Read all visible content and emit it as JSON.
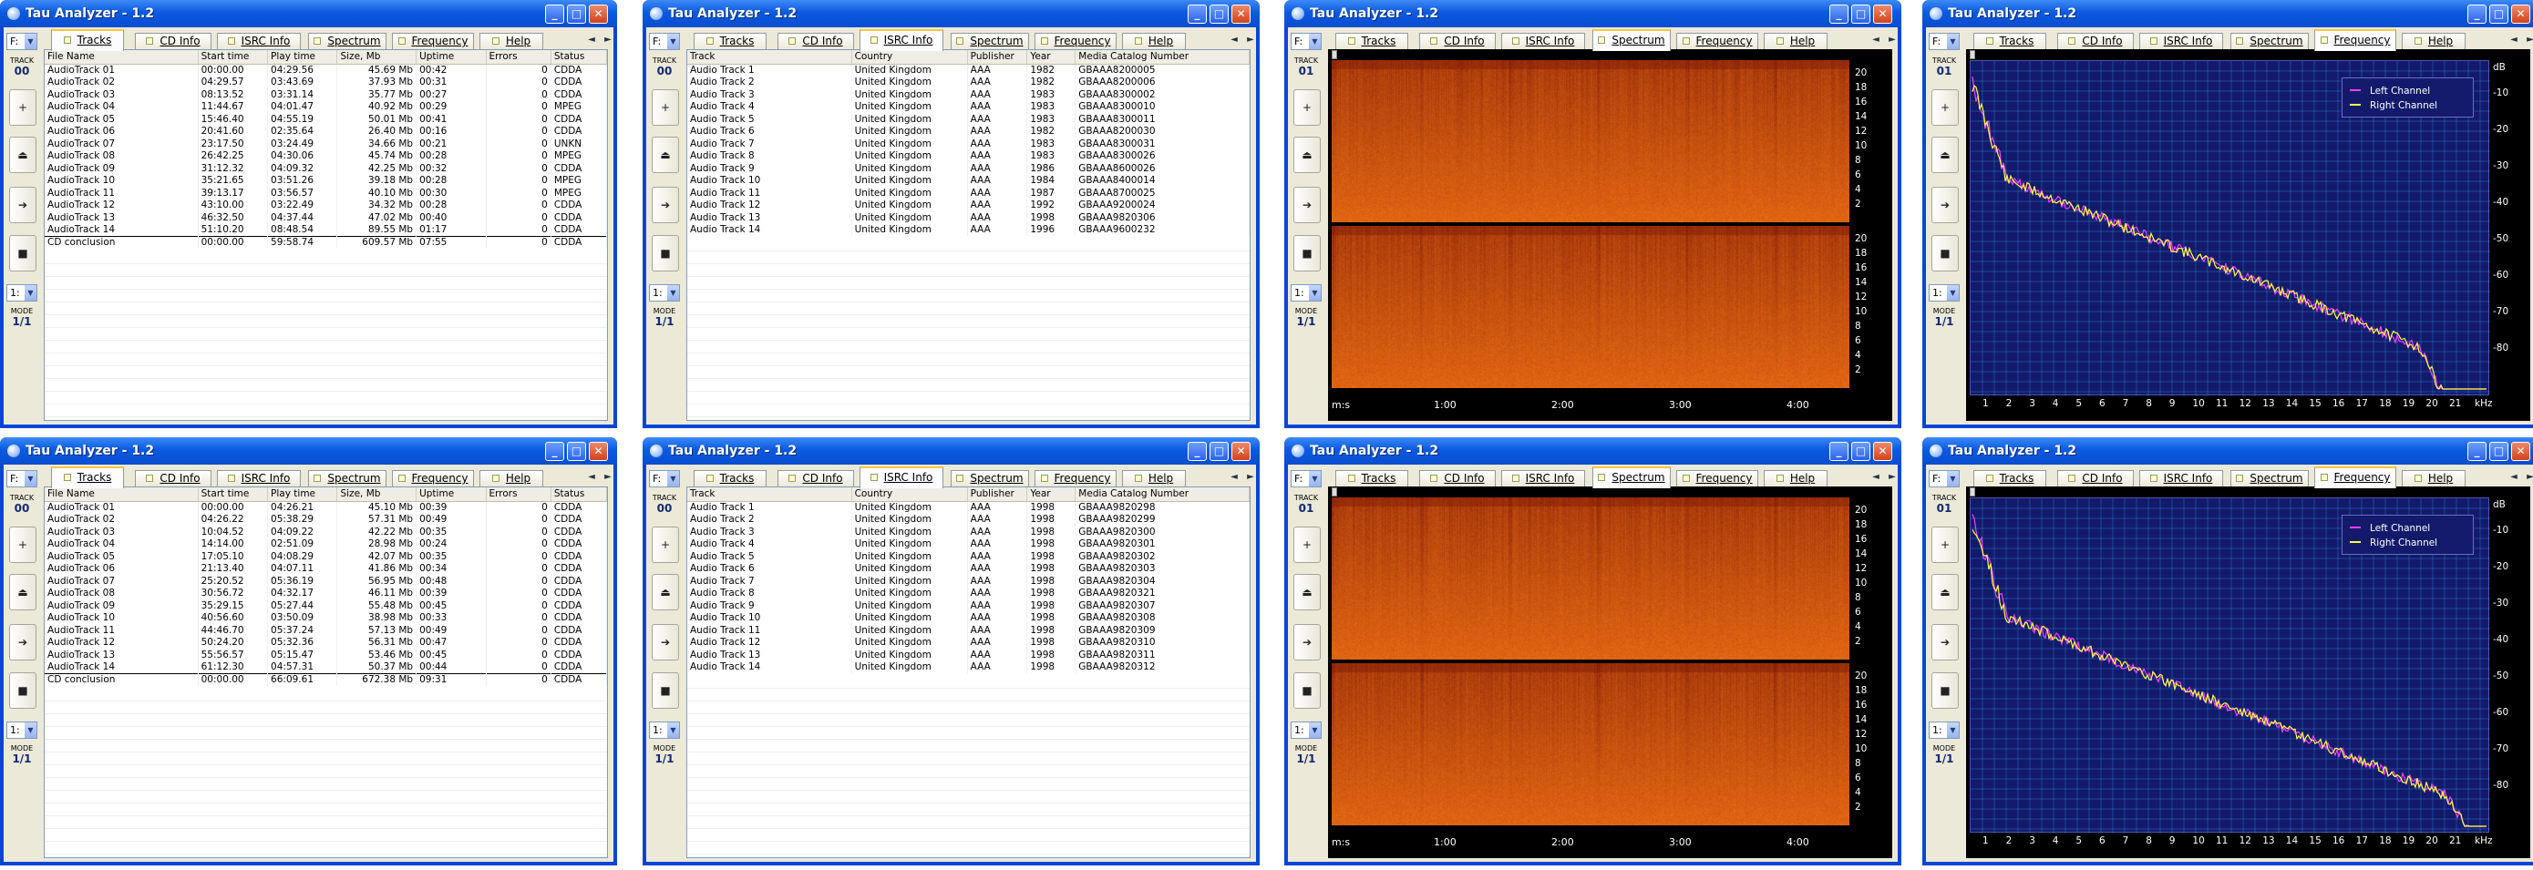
{
  "app_title": "Tau Analyzer - 1.2",
  "tabs": [
    "Tracks",
    "CD Info",
    "ISRC Info",
    "Spectrum",
    "Frequency",
    "Help"
  ],
  "sidebar": {
    "drive": "F:",
    "track_label": "TRACK",
    "mode_label": "MODE",
    "mode_value": "1/1",
    "small_select": "1:"
  },
  "windows": [
    {
      "id": "w1",
      "view": "tracks",
      "track_num": "00",
      "columns": [
        "File Name",
        "Start time",
        "Play time",
        "Size, Mb",
        "Uptime",
        "Errors",
        "Status"
      ],
      "rows": [
        [
          "AudioTrack 01",
          "00:00.00",
          "04:29.56",
          "45.69 Mb",
          "00:42",
          "0",
          "CDDA"
        ],
        [
          "AudioTrack 02",
          "04:29.57",
          "03:43.69",
          "37.93 Mb",
          "00:31",
          "0",
          "CDDA"
        ],
        [
          "AudioTrack 03",
          "08:13.52",
          "03:31.14",
          "35.77 Mb",
          "00:27",
          "0",
          "CDDA"
        ],
        [
          "AudioTrack 04",
          "11:44.67",
          "04:01.47",
          "40.92 Mb",
          "00:29",
          "0",
          "MPEG"
        ],
        [
          "AudioTrack 05",
          "15:46.40",
          "04:55.19",
          "50.01 Mb",
          "00:41",
          "0",
          "CDDA"
        ],
        [
          "AudioTrack 06",
          "20:41.60",
          "02:35.64",
          "26.40 Mb",
          "00:16",
          "0",
          "CDDA"
        ],
        [
          "AudioTrack 07",
          "23:17.50",
          "03:24.49",
          "34.66 Mb",
          "00:21",
          "0",
          "UNKN"
        ],
        [
          "AudioTrack 08",
          "26:42.25",
          "04:30.06",
          "45.74 Mb",
          "00:28",
          "0",
          "MPEG"
        ],
        [
          "AudioTrack 09",
          "31:12.32",
          "04:09.32",
          "42.25 Mb",
          "00:32",
          "0",
          "CDDA"
        ],
        [
          "AudioTrack 10",
          "35:21.65",
          "03:51.26",
          "39.18 Mb",
          "00:28",
          "0",
          "MPEG"
        ],
        [
          "AudioTrack 11",
          "39:13.17",
          "03:56.57",
          "40.10 Mb",
          "00:30",
          "0",
          "MPEG"
        ],
        [
          "AudioTrack 12",
          "43:10.00",
          "03:22.49",
          "34.32 Mb",
          "00:28",
          "0",
          "CDDA"
        ],
        [
          "AudioTrack 13",
          "46:32.50",
          "04:37.44",
          "47.02 Mb",
          "00:40",
          "0",
          "CDDA"
        ],
        [
          "AudioTrack 14",
          "51:10.20",
          "08:48.54",
          "89.55 Mb",
          "01:17",
          "0",
          "CDDA"
        ]
      ],
      "conclusion": [
        "CD conclusion",
        "00:00.00",
        "59:58.74",
        "609.57 Mb",
        "07:55",
        "0",
        "CDDA"
      ]
    },
    {
      "id": "w2",
      "view": "isrc",
      "track_num": "00",
      "columns": [
        "Track",
        "Country",
        "Publisher",
        "Year",
        "Media Catalog Number"
      ],
      "rows": [
        [
          "Audio Track 1",
          "United Kingdom",
          "AAA",
          "1982",
          "GBAAA8200005"
        ],
        [
          "Audio Track 2",
          "United Kingdom",
          "AAA",
          "1982",
          "GBAAA8200006"
        ],
        [
          "Audio Track 3",
          "United Kingdom",
          "AAA",
          "1983",
          "GBAAA8300002"
        ],
        [
          "Audio Track 4",
          "United Kingdom",
          "AAA",
          "1983",
          "GBAAA8300010"
        ],
        [
          "Audio Track 5",
          "United Kingdom",
          "AAA",
          "1983",
          "GBAAA8300011"
        ],
        [
          "Audio Track 6",
          "United Kingdom",
          "AAA",
          "1982",
          "GBAAA8200030"
        ],
        [
          "Audio Track 7",
          "United Kingdom",
          "AAA",
          "1983",
          "GBAAA8300031"
        ],
        [
          "Audio Track 8",
          "United Kingdom",
          "AAA",
          "1983",
          "GBAAA8300026"
        ],
        [
          "Audio Track 9",
          "United Kingdom",
          "AAA",
          "1986",
          "GBAAA8600026"
        ],
        [
          "Audio Track 10",
          "United Kingdom",
          "AAA",
          "1984",
          "GBAAA8400014"
        ],
        [
          "Audio Track 11",
          "United Kingdom",
          "AAA",
          "1987",
          "GBAAA8700025"
        ],
        [
          "Audio Track 12",
          "United Kingdom",
          "AAA",
          "1992",
          "GBAAA9200024"
        ],
        [
          "Audio Track 13",
          "United Kingdom",
          "AAA",
          "1998",
          "GBAAA9820306"
        ],
        [
          "Audio Track 14",
          "United Kingdom",
          "AAA",
          "1996",
          "GBAAA9600232"
        ]
      ]
    },
    {
      "id": "w3",
      "view": "spectrum",
      "track_num": "01"
    },
    {
      "id": "w4",
      "view": "frequency",
      "track_num": "01",
      "rolloff": true
    },
    {
      "id": "w5",
      "view": "tracks",
      "track_num": "00",
      "columns": [
        "File Name",
        "Start time",
        "Play time",
        "Size, Mb",
        "Uptime",
        "Errors",
        "Status"
      ],
      "rows": [
        [
          "AudioTrack 01",
          "00:00.00",
          "04:26.21",
          "45.10 Mb",
          "00:39",
          "0",
          "CDDA"
        ],
        [
          "AudioTrack 02",
          "04:26.22",
          "05:38.29",
          "57.31 Mb",
          "00:49",
          "0",
          "CDDA"
        ],
        [
          "AudioTrack 03",
          "10:04.52",
          "04:09.22",
          "42.22 Mb",
          "00:35",
          "0",
          "CDDA"
        ],
        [
          "AudioTrack 04",
          "14:14.00",
          "02:51.09",
          "28.98 Mb",
          "00:24",
          "0",
          "CDDA"
        ],
        [
          "AudioTrack 05",
          "17:05.10",
          "04:08.29",
          "42.07 Mb",
          "00:35",
          "0",
          "CDDA"
        ],
        [
          "AudioTrack 06",
          "21:13.40",
          "04:07.11",
          "41.86 Mb",
          "00:34",
          "0",
          "CDDA"
        ],
        [
          "AudioTrack 07",
          "25:20.52",
          "05:36.19",
          "56.95 Mb",
          "00:48",
          "0",
          "CDDA"
        ],
        [
          "AudioTrack 08",
          "30:56.72",
          "04:32.17",
          "46.11 Mb",
          "00:39",
          "0",
          "CDDA"
        ],
        [
          "AudioTrack 09",
          "35:29.15",
          "05:27.44",
          "55.48 Mb",
          "00:45",
          "0",
          "CDDA"
        ],
        [
          "AudioTrack 10",
          "40:56.60",
          "03:50.09",
          "38.98 Mb",
          "00:33",
          "0",
          "CDDA"
        ],
        [
          "AudioTrack 11",
          "44:46.70",
          "05:37.24",
          "57.13 Mb",
          "00:49",
          "0",
          "CDDA"
        ],
        [
          "AudioTrack 12",
          "50:24.20",
          "05:32.36",
          "56.31 Mb",
          "00:47",
          "0",
          "CDDA"
        ],
        [
          "AudioTrack 13",
          "55:56.57",
          "05:15.47",
          "53.46 Mb",
          "00:45",
          "0",
          "CDDA"
        ],
        [
          "AudioTrack 14",
          "61:12.30",
          "04:57.31",
          "50.37 Mb",
          "00:44",
          "0",
          "CDDA"
        ]
      ],
      "conclusion": [
        "CD conclusion",
        "00:00.00",
        "66:09.61",
        "672.38 Mb",
        "09:31",
        "0",
        "CDDA"
      ]
    },
    {
      "id": "w6",
      "view": "isrc",
      "track_num": "00",
      "columns": [
        "Track",
        "Country",
        "Publisher",
        "Year",
        "Media Catalog Number"
      ],
      "rows": [
        [
          "Audio Track 1",
          "United Kingdom",
          "AAA",
          "1998",
          "GBAAA9820298"
        ],
        [
          "Audio Track 2",
          "United Kingdom",
          "AAA",
          "1998",
          "GBAAA9820299"
        ],
        [
          "Audio Track 3",
          "United Kingdom",
          "AAA",
          "1998",
          "GBAAA9820300"
        ],
        [
          "Audio Track 4",
          "United Kingdom",
          "AAA",
          "1998",
          "GBAAA9820301"
        ],
        [
          "Audio Track 5",
          "United Kingdom",
          "AAA",
          "1998",
          "GBAAA9820302"
        ],
        [
          "Audio Track 6",
          "United Kingdom",
          "AAA",
          "1998",
          "GBAAA9820303"
        ],
        [
          "Audio Track 7",
          "United Kingdom",
          "AAA",
          "1998",
          "GBAAA9820304"
        ],
        [
          "Audio Track 8",
          "United Kingdom",
          "AAA",
          "1998",
          "GBAAA9820321"
        ],
        [
          "Audio Track 9",
          "United Kingdom",
          "AAA",
          "1998",
          "GBAAA9820307"
        ],
        [
          "Audio Track 10",
          "United Kingdom",
          "AAA",
          "1998",
          "GBAAA9820308"
        ],
        [
          "Audio Track 11",
          "United Kingdom",
          "AAA",
          "1998",
          "GBAAA9820309"
        ],
        [
          "Audio Track 12",
          "United Kingdom",
          "AAA",
          "1998",
          "GBAAA9820310"
        ],
        [
          "Audio Track 13",
          "United Kingdom",
          "AAA",
          "1998",
          "GBAAA9820311"
        ],
        [
          "Audio Track 14",
          "United Kingdom",
          "AAA",
          "1998",
          "GBAAA9820312"
        ]
      ]
    },
    {
      "id": "w7",
      "view": "spectrum",
      "track_num": "01"
    },
    {
      "id": "w8",
      "view": "frequency",
      "track_num": "01",
      "rolloff": false
    }
  ],
  "spectrum": {
    "y_ticks": [
      "20",
      "18",
      "16",
      "14",
      "12",
      "10",
      "8",
      "6",
      "4",
      "2"
    ],
    "x_unit": "m:s",
    "x_ticks": [
      "1:00",
      "2:00",
      "3:00",
      "4:00"
    ]
  },
  "frequency": {
    "legend": [
      {
        "name": "Left Channel",
        "color": "#ff3cff"
      },
      {
        "name": "Right Channel",
        "color": "#ffff40"
      }
    ],
    "y_unit": "dB",
    "y_ticks": [
      "-10",
      "-20",
      "-30",
      "-40",
      "-50",
      "-60",
      "-70",
      "-80"
    ],
    "x_ticks": [
      "1",
      "2",
      "3",
      "4",
      "5",
      "6",
      "7",
      "8",
      "9",
      "10",
      "11",
      "12",
      "13",
      "14",
      "15",
      "16",
      "17",
      "18",
      "19",
      "20",
      "21"
    ],
    "x_unit": "kHz"
  },
  "colors": {
    "titlebar": "#0a4dd0",
    "face": "#ece9d8",
    "spectrum_hot": "#e2661a",
    "plot_bg": "#131a6b"
  }
}
